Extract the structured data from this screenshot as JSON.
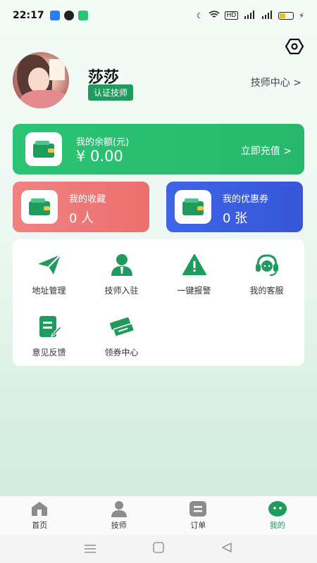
{
  "status": {
    "time": "22:17",
    "network": "HD"
  },
  "profile": {
    "name": "莎莎",
    "badge": "认证技师",
    "tech_center": "技师中心 >"
  },
  "balance": {
    "label": "我的余额(元)",
    "amount": "¥ 0.00",
    "action": "立即充值 >"
  },
  "favorites": {
    "label": "我的收藏",
    "value": "0 人"
  },
  "coupons": {
    "label": "我的优惠券",
    "value": "0 张"
  },
  "grid": [
    {
      "label": "地址管理",
      "icon": "paper-plane-icon"
    },
    {
      "label": "技师入驻",
      "icon": "technician-icon"
    },
    {
      "label": "一键报警",
      "icon": "alert-icon"
    },
    {
      "label": "我的客服",
      "icon": "headset-icon"
    },
    {
      "label": "意见反馈",
      "icon": "feedback-icon"
    },
    {
      "label": "领券中心",
      "icon": "tickets-icon"
    }
  ],
  "tabs": [
    {
      "label": "首页",
      "active": false
    },
    {
      "label": "技师",
      "active": false
    },
    {
      "label": "订单",
      "active": false
    },
    {
      "label": "我的",
      "active": true
    }
  ],
  "colors": {
    "primary_green": "#1f9b5d",
    "balance_green": "#2bc474",
    "fav_red": "#f08282",
    "coupon_blue": "#3e65e6"
  }
}
